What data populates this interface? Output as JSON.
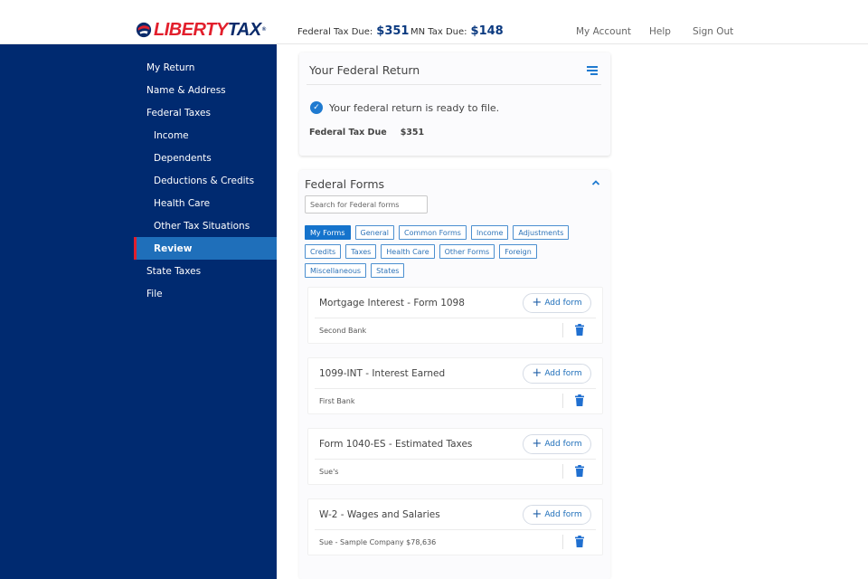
{
  "header": {
    "logo": {
      "part1": "LIBERTY",
      "part2": "TAX",
      "tm": "®"
    },
    "federal_due_label": "Federal Tax Due:",
    "federal_due_amount": "$351",
    "mn_due_label": "MN Tax Due:",
    "mn_due_amount": "$148",
    "links": {
      "account": "My Account",
      "help": "Help",
      "signout": "Sign Out"
    }
  },
  "sidebar": {
    "items": [
      {
        "label": "My Return",
        "level": 1
      },
      {
        "label": "Name & Address",
        "level": 1
      },
      {
        "label": "Federal Taxes",
        "level": 1
      },
      {
        "label": "Income",
        "level": 2
      },
      {
        "label": "Dependents",
        "level": 2
      },
      {
        "label": "Deductions & Credits",
        "level": 2
      },
      {
        "label": "Health Care",
        "level": 2
      },
      {
        "label": "Other Tax Situations",
        "level": 2
      },
      {
        "label": "Review",
        "level": 2,
        "active": true
      },
      {
        "label": "State Taxes",
        "level": 1
      },
      {
        "label": "File",
        "level": 1
      }
    ]
  },
  "return_card": {
    "title": "Your Federal Return",
    "status_text": "Your federal return is ready to file.",
    "due_label": "Federal Tax Due",
    "due_value": "$351"
  },
  "forms_card": {
    "title": "Federal Forms",
    "search_placeholder": "Search for Federal forms",
    "search_value": "",
    "filter_rows": [
      [
        "My Forms",
        "General",
        "Common Forms",
        "Income",
        "Adjustments"
      ],
      [
        "Credits",
        "Taxes",
        "Health Care",
        "Other Forms",
        "Foreign"
      ],
      [
        "Miscellaneous",
        "States"
      ]
    ],
    "active_filter": "My Forms",
    "add_label": "Add form",
    "items": [
      {
        "title": "Mortgage Interest - Form 1098",
        "entry": "Second Bank"
      },
      {
        "title": "1099-INT - Interest Earned",
        "entry": "First Bank"
      },
      {
        "title": "Form 1040-ES - Estimated Taxes",
        "entry": "Sue's"
      },
      {
        "title": "W-2 - Wages and Salaries",
        "entry": "Sue - Sample Company $78,636"
      }
    ]
  },
  "colors": {
    "sidebar_bg": "#002a70",
    "active_nav_bg": "#1f6fba",
    "active_nav_marker": "#e21f2c",
    "accent_blue": "#1f7ad0",
    "logo_red": "#e21f2c",
    "logo_navy": "#0b2b6b"
  }
}
